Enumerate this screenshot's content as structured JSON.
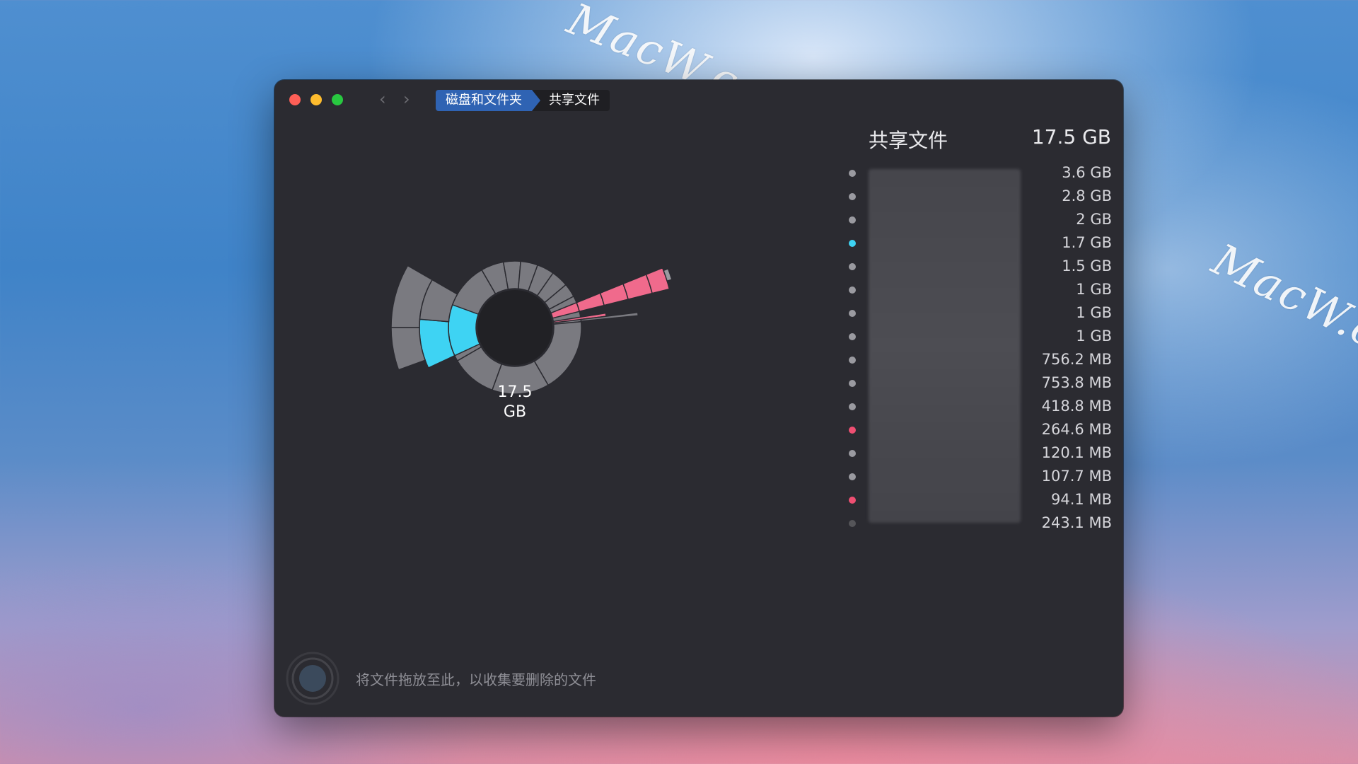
{
  "watermark": {
    "text": "MacW.com"
  },
  "window": {
    "controls": [
      "close",
      "minimize",
      "maximize"
    ],
    "nav": {
      "back_icon": "chevron-left-icon",
      "forward_icon": "chevron-right-icon"
    },
    "breadcrumb": [
      {
        "label": "磁盘和文件夹"
      },
      {
        "label": "共享文件"
      }
    ]
  },
  "chart": {
    "center_value": "17.5",
    "center_unit": "GB"
  },
  "panel": {
    "title": "共享文件",
    "total": "17.5 GB",
    "items": [
      {
        "size": "3.6 GB",
        "color": "#9a9aa0"
      },
      {
        "size": "2.8 GB",
        "color": "#9a9aa0"
      },
      {
        "size": "2   GB",
        "color": "#9a9aa0"
      },
      {
        "size": "1.7 GB",
        "color": "#3ed3f3"
      },
      {
        "size": "1.5 GB",
        "color": "#9a9aa0"
      },
      {
        "size": "1   GB",
        "color": "#9a9aa0"
      },
      {
        "size": "1   GB",
        "color": "#9a9aa0"
      },
      {
        "size": "1   GB",
        "color": "#9a9aa0"
      },
      {
        "size": "756.2 MB",
        "color": "#9a9aa0"
      },
      {
        "size": "753.8 MB",
        "color": "#9a9aa0"
      },
      {
        "size": "418.8 MB",
        "color": "#9a9aa0"
      },
      {
        "size": "264.6 MB",
        "color": "#ef4f72"
      },
      {
        "size": "120.1 MB",
        "color": "#9a9aa0"
      },
      {
        "size": "107.7 MB",
        "color": "#9a9aa0"
      },
      {
        "size": "94.1 MB",
        "color": "#ef4f72"
      },
      {
        "size": "243.1 MB",
        "color": "#555559"
      }
    ]
  },
  "drop_zone": {
    "text": "将文件拖放至此，以收集要删除的文件"
  },
  "colors": {
    "accent": "#2f63b3",
    "segment_gray": "#7a7a80",
    "segment_cyan": "#3ed3f3",
    "segment_pink": "#f06a8c"
  }
}
